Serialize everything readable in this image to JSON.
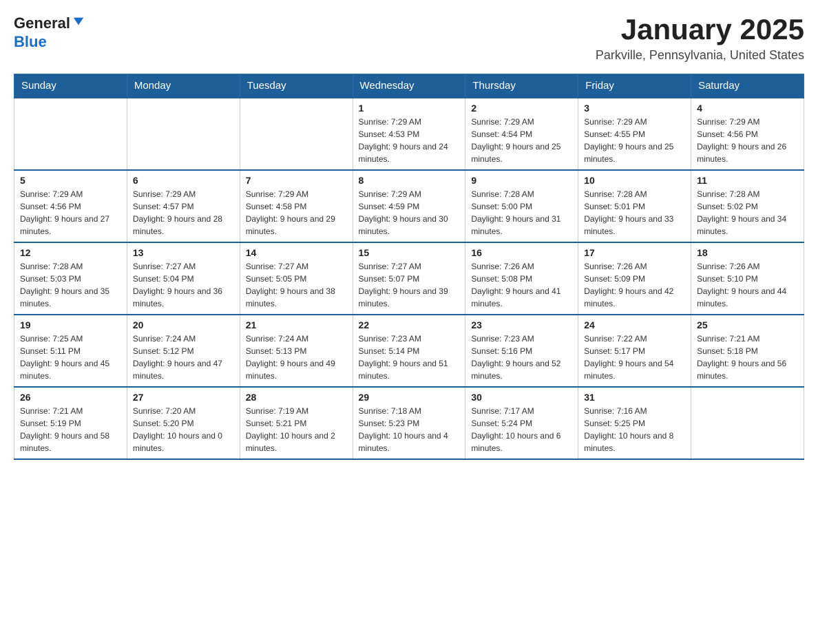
{
  "header": {
    "logo_general": "General",
    "logo_blue": "Blue",
    "month_title": "January 2025",
    "location": "Parkville, Pennsylvania, United States"
  },
  "weekdays": [
    "Sunday",
    "Monday",
    "Tuesday",
    "Wednesday",
    "Thursday",
    "Friday",
    "Saturday"
  ],
  "weeks": [
    [
      {
        "day": "",
        "sunrise": "",
        "sunset": "",
        "daylight": ""
      },
      {
        "day": "",
        "sunrise": "",
        "sunset": "",
        "daylight": ""
      },
      {
        "day": "",
        "sunrise": "",
        "sunset": "",
        "daylight": ""
      },
      {
        "day": "1",
        "sunrise": "Sunrise: 7:29 AM",
        "sunset": "Sunset: 4:53 PM",
        "daylight": "Daylight: 9 hours and 24 minutes."
      },
      {
        "day": "2",
        "sunrise": "Sunrise: 7:29 AM",
        "sunset": "Sunset: 4:54 PM",
        "daylight": "Daylight: 9 hours and 25 minutes."
      },
      {
        "day": "3",
        "sunrise": "Sunrise: 7:29 AM",
        "sunset": "Sunset: 4:55 PM",
        "daylight": "Daylight: 9 hours and 25 minutes."
      },
      {
        "day": "4",
        "sunrise": "Sunrise: 7:29 AM",
        "sunset": "Sunset: 4:56 PM",
        "daylight": "Daylight: 9 hours and 26 minutes."
      }
    ],
    [
      {
        "day": "5",
        "sunrise": "Sunrise: 7:29 AM",
        "sunset": "Sunset: 4:56 PM",
        "daylight": "Daylight: 9 hours and 27 minutes."
      },
      {
        "day": "6",
        "sunrise": "Sunrise: 7:29 AM",
        "sunset": "Sunset: 4:57 PM",
        "daylight": "Daylight: 9 hours and 28 minutes."
      },
      {
        "day": "7",
        "sunrise": "Sunrise: 7:29 AM",
        "sunset": "Sunset: 4:58 PM",
        "daylight": "Daylight: 9 hours and 29 minutes."
      },
      {
        "day": "8",
        "sunrise": "Sunrise: 7:29 AM",
        "sunset": "Sunset: 4:59 PM",
        "daylight": "Daylight: 9 hours and 30 minutes."
      },
      {
        "day": "9",
        "sunrise": "Sunrise: 7:28 AM",
        "sunset": "Sunset: 5:00 PM",
        "daylight": "Daylight: 9 hours and 31 minutes."
      },
      {
        "day": "10",
        "sunrise": "Sunrise: 7:28 AM",
        "sunset": "Sunset: 5:01 PM",
        "daylight": "Daylight: 9 hours and 33 minutes."
      },
      {
        "day": "11",
        "sunrise": "Sunrise: 7:28 AM",
        "sunset": "Sunset: 5:02 PM",
        "daylight": "Daylight: 9 hours and 34 minutes."
      }
    ],
    [
      {
        "day": "12",
        "sunrise": "Sunrise: 7:28 AM",
        "sunset": "Sunset: 5:03 PM",
        "daylight": "Daylight: 9 hours and 35 minutes."
      },
      {
        "day": "13",
        "sunrise": "Sunrise: 7:27 AM",
        "sunset": "Sunset: 5:04 PM",
        "daylight": "Daylight: 9 hours and 36 minutes."
      },
      {
        "day": "14",
        "sunrise": "Sunrise: 7:27 AM",
        "sunset": "Sunset: 5:05 PM",
        "daylight": "Daylight: 9 hours and 38 minutes."
      },
      {
        "day": "15",
        "sunrise": "Sunrise: 7:27 AM",
        "sunset": "Sunset: 5:07 PM",
        "daylight": "Daylight: 9 hours and 39 minutes."
      },
      {
        "day": "16",
        "sunrise": "Sunrise: 7:26 AM",
        "sunset": "Sunset: 5:08 PM",
        "daylight": "Daylight: 9 hours and 41 minutes."
      },
      {
        "day": "17",
        "sunrise": "Sunrise: 7:26 AM",
        "sunset": "Sunset: 5:09 PM",
        "daylight": "Daylight: 9 hours and 42 minutes."
      },
      {
        "day": "18",
        "sunrise": "Sunrise: 7:26 AM",
        "sunset": "Sunset: 5:10 PM",
        "daylight": "Daylight: 9 hours and 44 minutes."
      }
    ],
    [
      {
        "day": "19",
        "sunrise": "Sunrise: 7:25 AM",
        "sunset": "Sunset: 5:11 PM",
        "daylight": "Daylight: 9 hours and 45 minutes."
      },
      {
        "day": "20",
        "sunrise": "Sunrise: 7:24 AM",
        "sunset": "Sunset: 5:12 PM",
        "daylight": "Daylight: 9 hours and 47 minutes."
      },
      {
        "day": "21",
        "sunrise": "Sunrise: 7:24 AM",
        "sunset": "Sunset: 5:13 PM",
        "daylight": "Daylight: 9 hours and 49 minutes."
      },
      {
        "day": "22",
        "sunrise": "Sunrise: 7:23 AM",
        "sunset": "Sunset: 5:14 PM",
        "daylight": "Daylight: 9 hours and 51 minutes."
      },
      {
        "day": "23",
        "sunrise": "Sunrise: 7:23 AM",
        "sunset": "Sunset: 5:16 PM",
        "daylight": "Daylight: 9 hours and 52 minutes."
      },
      {
        "day": "24",
        "sunrise": "Sunrise: 7:22 AM",
        "sunset": "Sunset: 5:17 PM",
        "daylight": "Daylight: 9 hours and 54 minutes."
      },
      {
        "day": "25",
        "sunrise": "Sunrise: 7:21 AM",
        "sunset": "Sunset: 5:18 PM",
        "daylight": "Daylight: 9 hours and 56 minutes."
      }
    ],
    [
      {
        "day": "26",
        "sunrise": "Sunrise: 7:21 AM",
        "sunset": "Sunset: 5:19 PM",
        "daylight": "Daylight: 9 hours and 58 minutes."
      },
      {
        "day": "27",
        "sunrise": "Sunrise: 7:20 AM",
        "sunset": "Sunset: 5:20 PM",
        "daylight": "Daylight: 10 hours and 0 minutes."
      },
      {
        "day": "28",
        "sunrise": "Sunrise: 7:19 AM",
        "sunset": "Sunset: 5:21 PM",
        "daylight": "Daylight: 10 hours and 2 minutes."
      },
      {
        "day": "29",
        "sunrise": "Sunrise: 7:18 AM",
        "sunset": "Sunset: 5:23 PM",
        "daylight": "Daylight: 10 hours and 4 minutes."
      },
      {
        "day": "30",
        "sunrise": "Sunrise: 7:17 AM",
        "sunset": "Sunset: 5:24 PM",
        "daylight": "Daylight: 10 hours and 6 minutes."
      },
      {
        "day": "31",
        "sunrise": "Sunrise: 7:16 AM",
        "sunset": "Sunset: 5:25 PM",
        "daylight": "Daylight: 10 hours and 8 minutes."
      },
      {
        "day": "",
        "sunrise": "",
        "sunset": "",
        "daylight": ""
      }
    ]
  ]
}
